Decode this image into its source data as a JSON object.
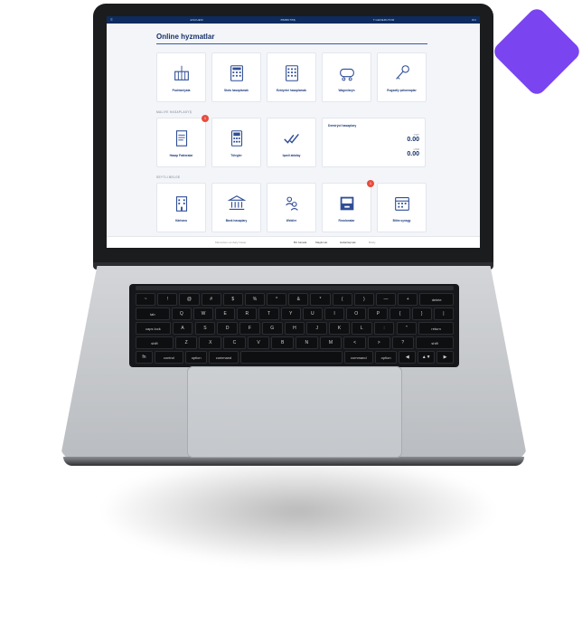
{
  "topbar": {
    "left": "☰",
    "center_left": "ESCHEM",
    "center": "ƏMƏKTƏŞ",
    "center_right": "T.GENERUTOR",
    "right": "RU"
  },
  "page_title": "Online hyzmatlar",
  "row1": [
    {
      "label": "Pochtaniyata",
      "icon": "container-icon"
    },
    {
      "label": "Stola hasaplamak",
      "icon": "calculator-icon"
    },
    {
      "label": "Ezbiyetni hasaplamak",
      "icon": "calculator-grid-icon"
    },
    {
      "label": "Wagonlaryn",
      "icon": "tanker-wagon-icon"
    },
    {
      "label": "Rugsatly şahanraplar",
      "icon": "key-icon"
    }
  ],
  "section2_label": "MALIYE HASAPLASYŞ",
  "row2": [
    {
      "label": "Hasap Faktoralar",
      "icon": "invoice-icon",
      "badge": "1"
    },
    {
      "label": "Tölegler",
      "icon": "payment-terminal-icon"
    },
    {
      "label": "Işanli aktalay",
      "icon": "double-check-icon"
    }
  ],
  "balance": {
    "title": "Demirýol hasaplary",
    "cur1": "TMT",
    "amt1": "0.00",
    "cur2": "USD",
    "amt2": "0.00"
  },
  "section3_label": "SEYTLI BELGE",
  "row3": [
    {
      "label": "Kärhana",
      "icon": "building-icon"
    },
    {
      "label": "Bank hasaplary",
      "icon": "bank-icon"
    },
    {
      "label": "Webiler",
      "icon": "users-icon"
    },
    {
      "label": "Rezolanalar",
      "icon": "archive-icon",
      "badge": "1"
    },
    {
      "label": "Bitim synagy",
      "icon": "calendar-icon"
    }
  ],
  "footer": {
    "copy": "Maneshem ambaly hasap",
    "links": [
      "Biz barada",
      "Maglumat",
      "Habarlaşmak"
    ],
    "extra": "Boldy"
  },
  "colors": {
    "accent": "#17306b",
    "brand_purple": "#7a44f0",
    "badge": "#e74c3c"
  },
  "keyboard": {
    "row1": [
      "~",
      "!",
      "@",
      "#",
      "$",
      "%",
      "^",
      "&",
      "*",
      "(",
      ")",
      "—",
      "+",
      "delete"
    ],
    "row2": [
      "tab",
      "Q",
      "W",
      "E",
      "R",
      "T",
      "Y",
      "U",
      "I",
      "O",
      "P",
      "{",
      "}",
      "|"
    ],
    "row3": [
      "caps lock",
      "A",
      "S",
      "D",
      "F",
      "G",
      "H",
      "J",
      "K",
      "L",
      ":",
      "\"",
      "return"
    ],
    "row4": [
      "shift",
      "Z",
      "X",
      "C",
      "V",
      "B",
      "N",
      "M",
      "<",
      ">",
      "?",
      "shift"
    ],
    "row5": [
      "fn",
      "control",
      "option",
      "command",
      "",
      "command",
      "option",
      "◀",
      "▲▼",
      "▶"
    ]
  }
}
